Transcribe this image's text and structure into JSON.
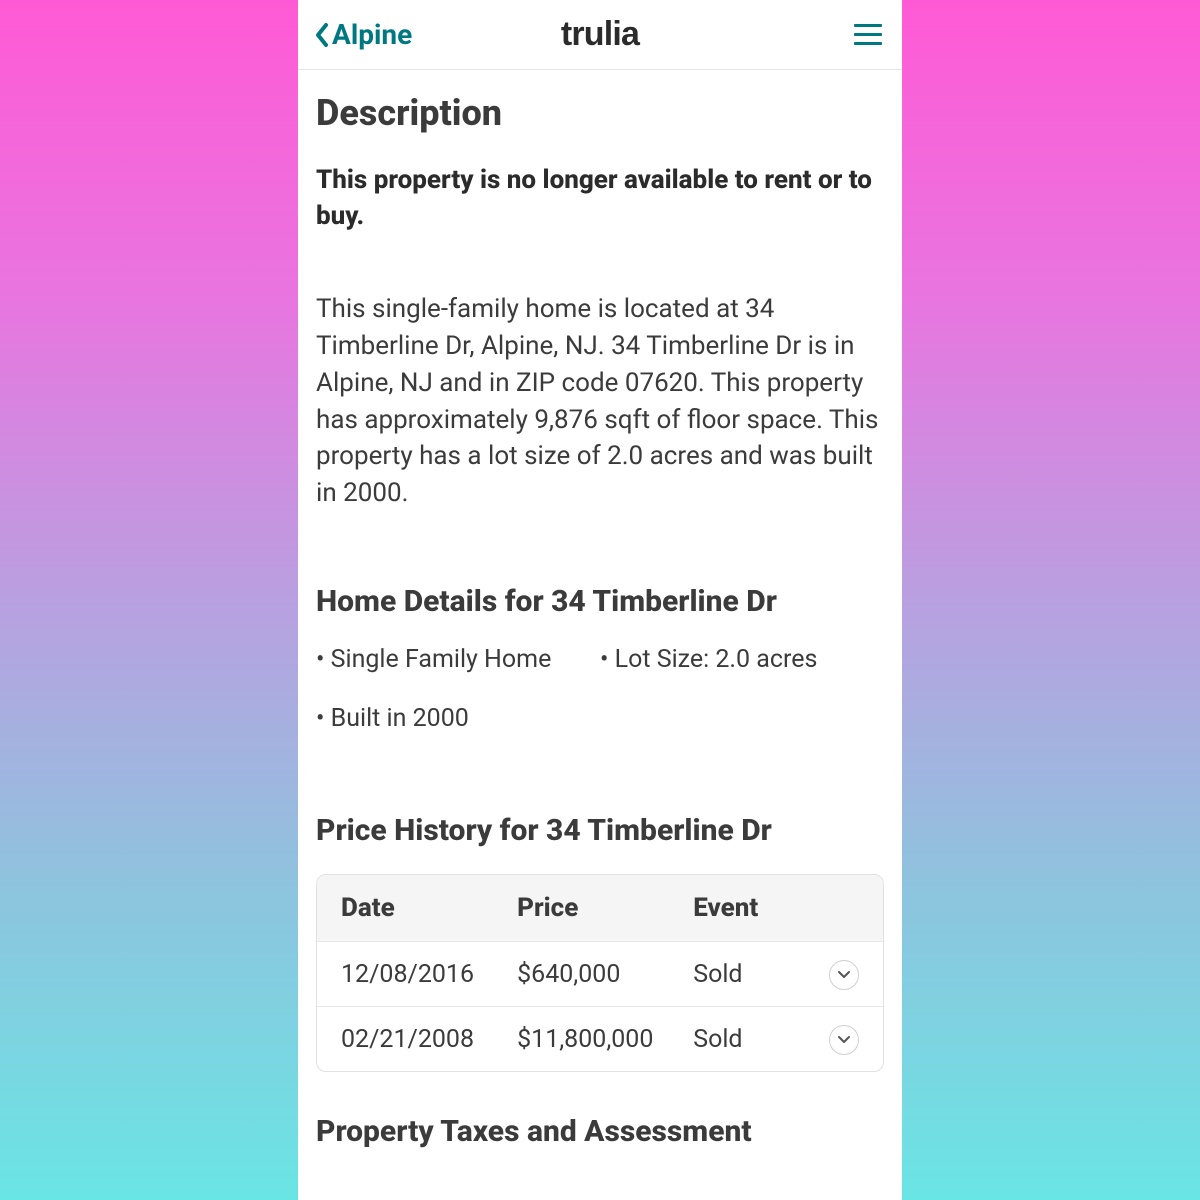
{
  "header": {
    "back_label": "Alpine",
    "logo": "trulia"
  },
  "description": {
    "title": "Description",
    "lead": "This property is no longer available to rent or to buy.",
    "body": "This single-family home is located at 34 Timberline Dr, Alpine, NJ. 34 Timberline Dr is in Alpine, NJ and in ZIP code 07620. This property has approximately 9,876 sqft of floor space. This property has a lot size of 2.0 acres and was built in 2000."
  },
  "details": {
    "title": "Home Details for 34 Timberline Dr",
    "items": [
      "Single Family Home",
      "Lot Size: 2.0 acres",
      "Built in 2000"
    ]
  },
  "price_history": {
    "title": "Price History for 34 Timberline Dr",
    "columns": {
      "date": "Date",
      "price": "Price",
      "event": "Event"
    },
    "rows": [
      {
        "date": "12/08/2016",
        "price": "$640,000",
        "event": "Sold"
      },
      {
        "date": "02/21/2008",
        "price": "$11,800,000",
        "event": "Sold"
      }
    ]
  },
  "taxes": {
    "title": "Property Taxes and Assessment"
  }
}
